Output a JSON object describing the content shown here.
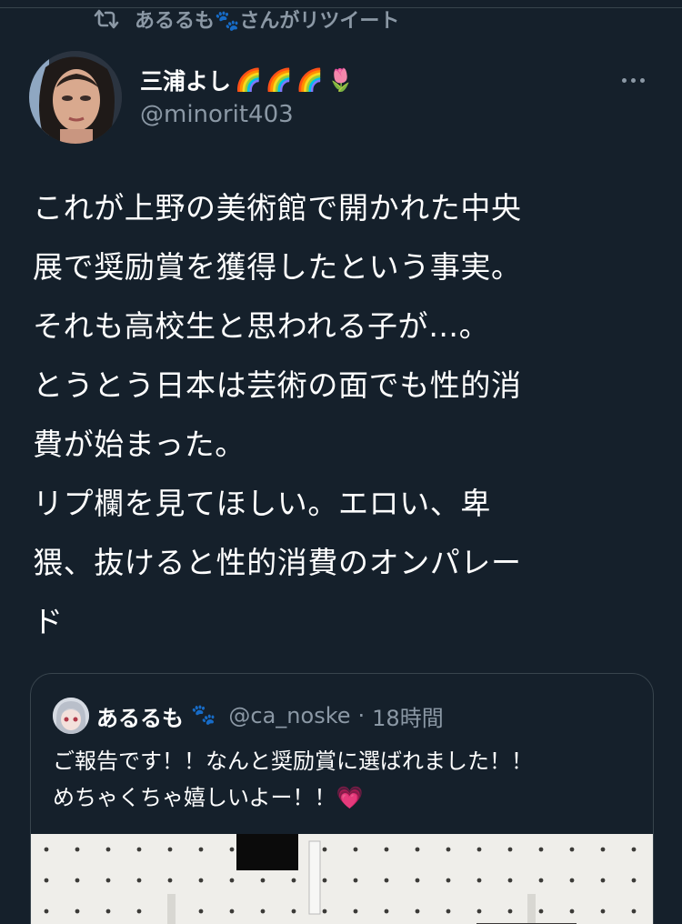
{
  "retweet": {
    "icon": "retweet-icon",
    "text": "あるるも🐾さんがリツイート"
  },
  "tweet": {
    "author_name": "三浦よし",
    "name_emojis": [
      "🌈",
      "🌈",
      "🌈",
      "🌷"
    ],
    "handle": "@minorit403",
    "lines": [
      "これが上野の美術館で開かれた中央",
      "展で奨励賞を獲得したという事実。",
      "それも高校生と思われる子が…。",
      "とうとう日本は芸術の面でも性的消",
      "費が始まった。",
      "リプ欄を見てほしい。エロい、卑",
      "猥、抜けると性的消費のオンパレー",
      "ド"
    ]
  },
  "quote": {
    "author_name": "あるるも",
    "name_emoji": "🐾",
    "handle": "@ca_noske",
    "separator": "·",
    "time": "18時間",
    "lines": [
      "ご報告です！！なんと奨励賞に選ばれました！！",
      "めちゃくちゃ嬉しいよー！！💗"
    ]
  },
  "colors": {
    "background": "#15202b",
    "secondary_text": "#8b98a5",
    "border": "#38444d",
    "primary_text": "#ffffff"
  }
}
